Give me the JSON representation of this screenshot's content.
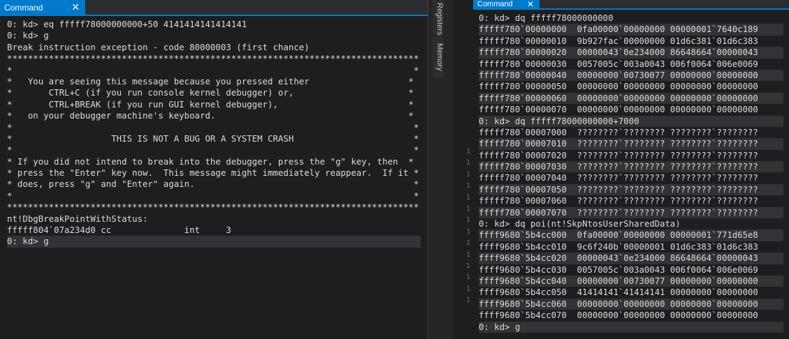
{
  "left": {
    "tab_title": "Command",
    "close_glyph": "✕",
    "lines": [
      "0: kd> eq fffff78000000000+50 4141414141414141",
      "0: kd> g",
      "Break instruction exception - code 80000003 (first chance)",
      "*******************************************************************************",
      "*                                                                             *",
      "*   You are seeing this message because you pressed either                   *",
      "*       CTRL+C (if you run console kernel debugger) or,                      *",
      "*       CTRL+BREAK (if you run GUI kernel debugger),                         *",
      "*   on your debugger machine's keyboard.                                     *",
      "*                                                                             *",
      "*                   THIS IS NOT A BUG OR A SYSTEM CRASH                       *",
      "*                                                                             *",
      "* If you did not intend to break into the debugger, press the \"g\" key, then  *",
      "* press the \"Enter\" key now.  This message might immediately reappear.  If it *",
      "* does, press \"g\" and \"Enter\" again.                                          *",
      "*                                                                             *",
      "*******************************************************************************",
      "nt!DbgBreakPointWithStatus:",
      "fffff804`07a234d0 cc              int     3",
      "0: kd> g"
    ]
  },
  "sidebar": {
    "registers_label": "Registers",
    "memory_label": "Memory",
    "gutter_numbers": [
      "1",
      "1",
      "1",
      "1",
      "1",
      "1",
      "1",
      "1",
      "1",
      "1",
      "1",
      "1",
      "1",
      "1"
    ]
  },
  "right": {
    "tab_title": "Command",
    "close_glyph": "✕",
    "lines": [
      "0: kd> dq fffff78000000000",
      "fffff780`00000000  0fa00000`00000000 00000001`7640c189",
      "fffff780`00000010  9b927fac`00000000 01d6c381`01d6c383",
      "fffff780`00000020  00000043`0e234000 86648664`00000043",
      "fffff780`00000030  0057005c`003a0043 006f0064`006e0069",
      "fffff780`00000040  00000000`00730077 00000000`00000000",
      "fffff780`00000050  00000000`00000000 00000000`00000000",
      "fffff780`00000060  00000000`00000000 00000000`00000000",
      "fffff780`00000070  00000000`00000000 00000000`00000000",
      "0: kd> dq fffff78000000000+7000",
      "fffff780`00007000  ????????`???????? ????????`????????",
      "fffff780`00007010  ????????`???????? ????????`????????",
      "fffff780`00007020  ????????`???????? ????????`????????",
      "fffff780`00007030  ????????`???????? ????????`????????",
      "fffff780`00007040  ????????`???????? ????????`????????",
      "fffff780`00007050  ????????`???????? ????????`????????",
      "fffff780`00007060  ????????`???????? ????????`????????",
      "fffff780`00007070  ????????`???????? ????????`????????",
      "0: kd> dq poi(nt!SkpNtosUserSharedData)",
      "ffff9680`5b4cc000  0fa00000`00000000 00000001`771d65e8",
      "ffff9680`5b4cc010  9c6f240b`00000001 01d6c383`01d6c383",
      "ffff9680`5b4cc020  00000043`0e234000 86648664`00000043",
      "ffff9680`5b4cc030  0057005c`003a0043 006f0064`006e0069",
      "ffff9680`5b4cc040  00000000`00730077 00000000`00000000",
      "ffff9680`5b4cc050  41414141`41414141 00000000`00000000",
      "ffff9680`5b4cc060  00000000`00000000 00000000`00000000",
      "ffff9680`5b4cc070  00000000`00000000 00000000`00000000",
      "0: kd> g"
    ]
  },
  "colors": {
    "accent": "#007acc",
    "background": "#1e1e1e",
    "text": "#dcdcdc",
    "highlight_row": "#333337"
  }
}
